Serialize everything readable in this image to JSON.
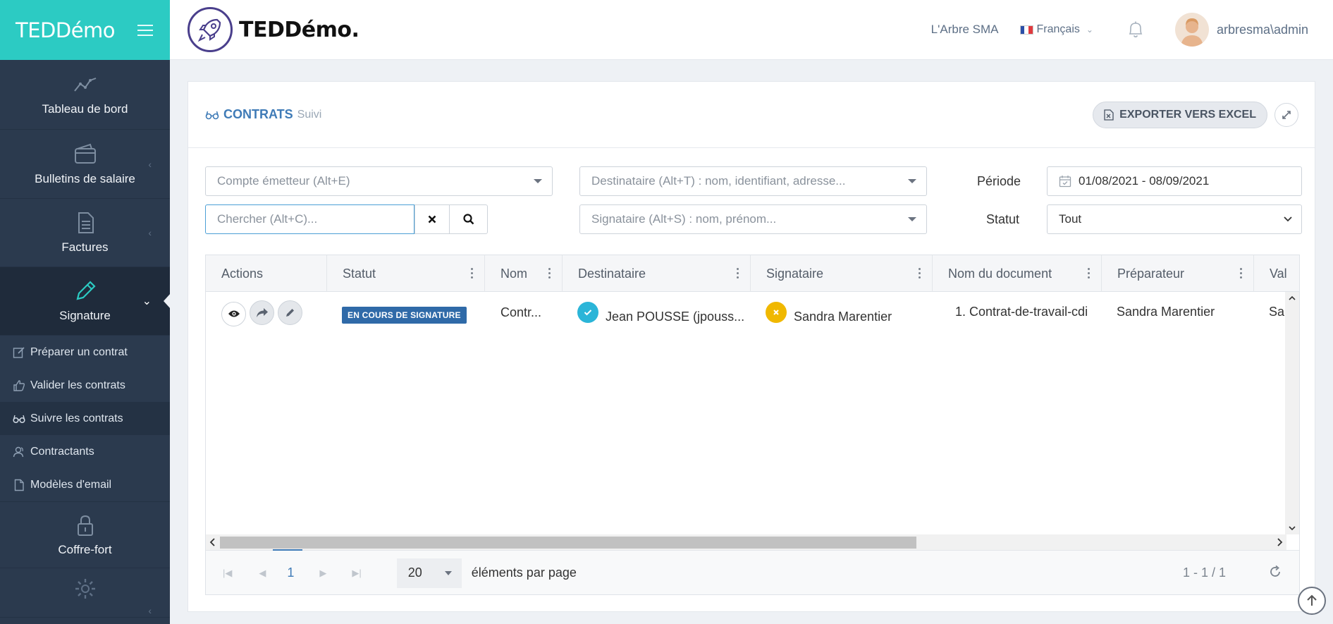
{
  "app": {
    "brand": "TEDDémo",
    "logo_text": "TEDDémo."
  },
  "sidebar": {
    "items": [
      {
        "label": "Tableau de bord"
      },
      {
        "label": "Bulletins de salaire"
      },
      {
        "label": "Factures"
      },
      {
        "label": "Signature"
      },
      {
        "label": "Coffre-fort"
      }
    ],
    "sub_items": [
      {
        "label": "Préparer un contrat"
      },
      {
        "label": "Valider les contrats"
      },
      {
        "label": "Suivre les contrats"
      },
      {
        "label": "Contractants"
      },
      {
        "label": "Modèles d'email"
      }
    ]
  },
  "topbar": {
    "org": "L'Arbre SMA",
    "language": "Français",
    "user": "arbresma\\admin"
  },
  "panel": {
    "title": "CONTRATS",
    "subtitle": "Suivi",
    "export_label": "EXPORTER VERS EXCEL"
  },
  "filters": {
    "emitter_placeholder": "Compte émetteur (Alt+E)",
    "recipient_placeholder": "Destinataire (Alt+T) : nom, identifiant, adresse...",
    "search_placeholder": "Chercher (Alt+C)...",
    "signer_placeholder": "Signataire (Alt+S) : nom, prénom...",
    "period_label": "Période",
    "period_value": "01/08/2021 - 08/09/2021",
    "status_label": "Statut",
    "status_value": "Tout"
  },
  "grid": {
    "columns": [
      "Actions",
      "Statut",
      "Nom",
      "Destinataire",
      "Signataire",
      "Nom du document",
      "Préparateur",
      "Val"
    ],
    "rows": [
      {
        "statut": "EN COURS DE SIGNATURE",
        "nom": "Contr...",
        "destinataire": "Jean POUSSE (jpouss...",
        "signataire": "Sandra Marentier",
        "document": "1. Contrat-de-travail-cdi",
        "preparateur": "Sandra Marentier",
        "val": "Sar"
      }
    ],
    "pager": {
      "current_page": "1",
      "page_size": "20",
      "page_size_label": "éléments par page",
      "count": "1 - 1 / 1"
    }
  },
  "colors": {
    "accent": "#2ccbc3",
    "sidebar": "#2b3a4e",
    "primary": "#3f7bb7",
    "badge": "#2f6aa8",
    "ok": "#2bb5d8",
    "pending": "#f0b800"
  }
}
